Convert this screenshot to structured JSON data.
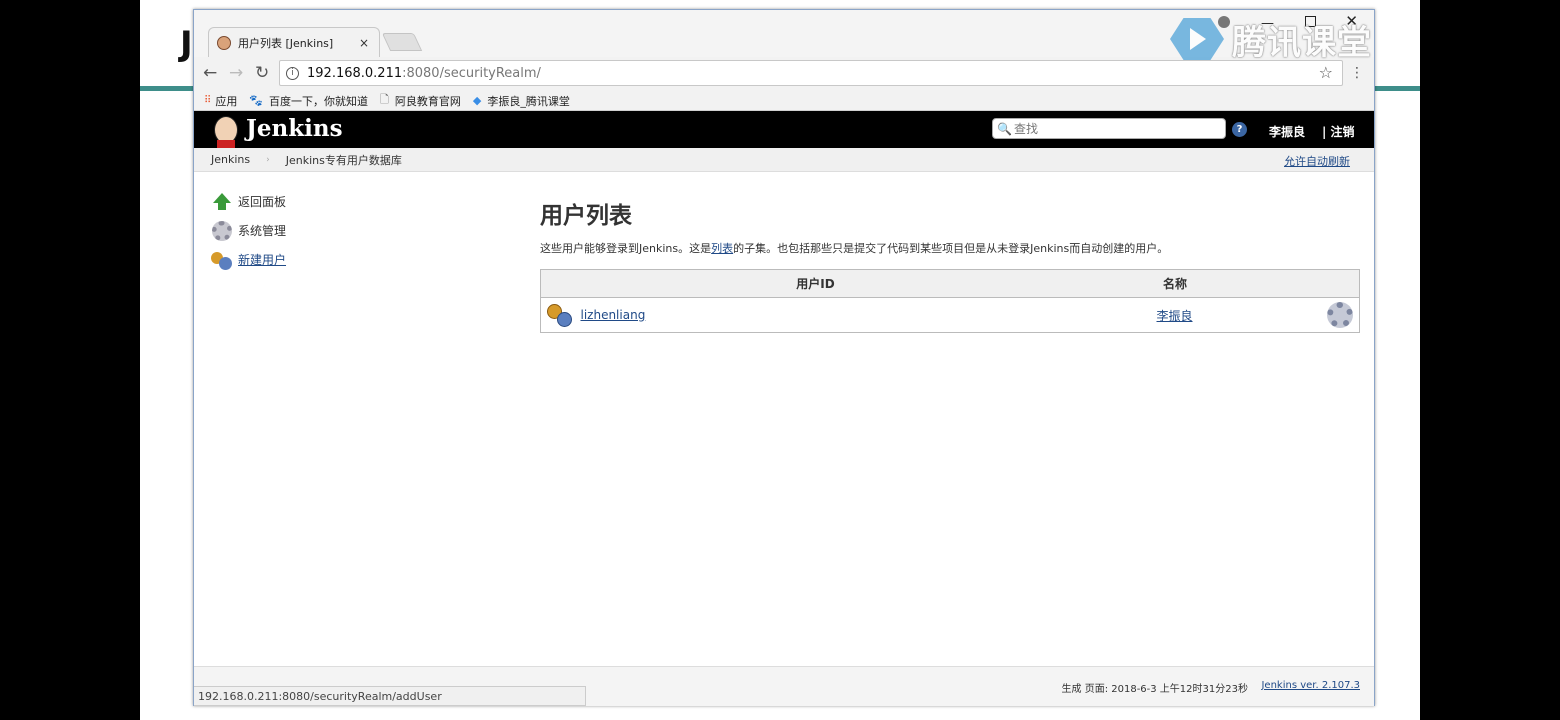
{
  "browser": {
    "tab_title": "用户列表 [Jenkins]",
    "tab_close": "×",
    "url_host": "192.168.0.211",
    "url_rest": ":8080/securityRealm/",
    "bookmarks": [
      {
        "label": "应用"
      },
      {
        "label": "百度一下，你就知道"
      },
      {
        "label": "阿良教育官网"
      },
      {
        "label": "李振良_腾讯课堂"
      }
    ],
    "status_url": "192.168.0.211:8080/securityRealm/addUser"
  },
  "watermark": {
    "text": "腾讯课堂"
  },
  "slide": {
    "letter": "J"
  },
  "jenkins": {
    "title": "Jenkins",
    "search_placeholder": "查找",
    "help": "?",
    "user": "李振良",
    "logout": "| 注销"
  },
  "breadcrumb": {
    "items": [
      "Jenkins",
      "Jenkins专有用户数据库"
    ],
    "sep": "›",
    "auto_refresh": "允许自动刷新"
  },
  "side": {
    "items": [
      {
        "label": "返回面板"
      },
      {
        "label": "系统管理"
      },
      {
        "label": "新建用户"
      }
    ]
  },
  "main": {
    "title": "用户列表",
    "desc_before": "这些用户能够登录到Jenkins。这是",
    "desc_link": "列表",
    "desc_after": "的子集。也包括那些只是提交了代码到某些项目但是从未登录Jenkins而自动创建的用户。",
    "table": {
      "headers": [
        "用户ID",
        "名称"
      ],
      "rows": [
        {
          "id": "lizhenliang",
          "name": "李振良"
        }
      ]
    }
  },
  "footer": {
    "generated": "生成 页面: 2018-6-3 上午12时31分23秒",
    "version": "Jenkins ver. 2.107.3"
  }
}
